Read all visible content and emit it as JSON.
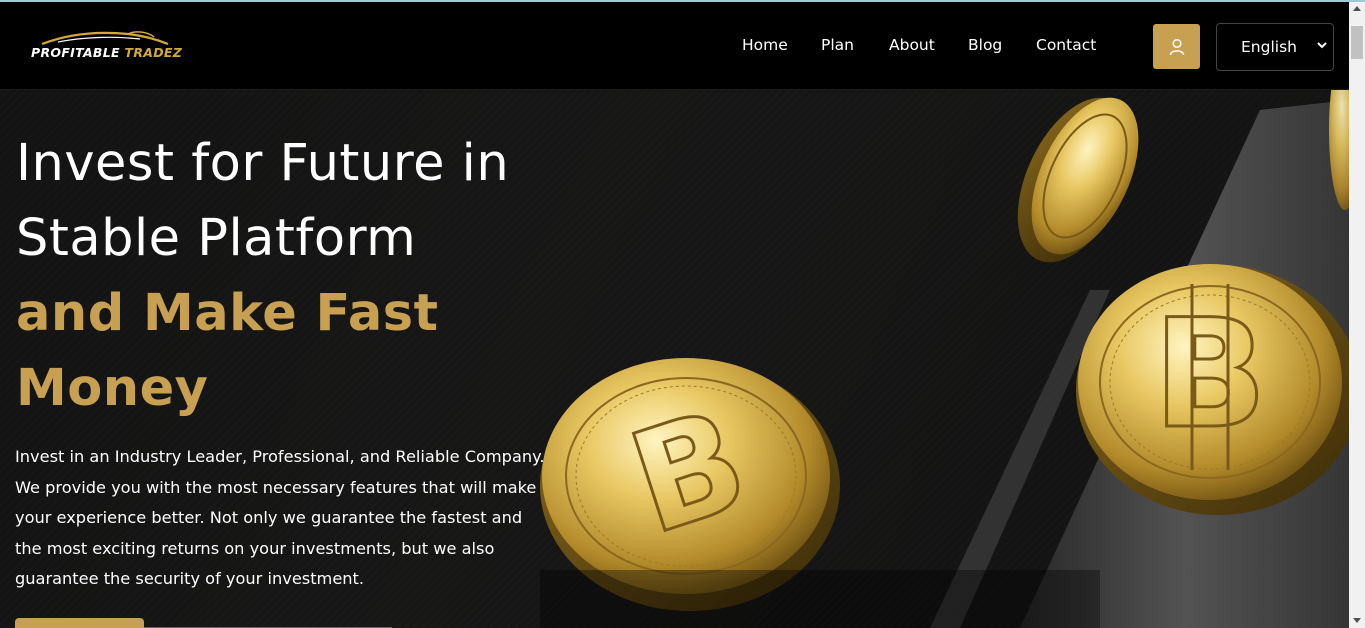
{
  "brand": {
    "logo_text_primary": "PROFITABLE",
    "logo_text_accent": "TRADEZ",
    "accent_color": "#c8a052"
  },
  "nav": {
    "items": [
      "Home",
      "Plan",
      "About",
      "Blog",
      "Contact"
    ]
  },
  "header": {
    "user_icon": "user-icon",
    "language_selected": "English"
  },
  "hero": {
    "title_line_1": "Invest for Future in",
    "title_line_2": "Stable Platform",
    "title_line_3": "and Make Fast",
    "title_line_4": "Money",
    "description": "Invest in an Industry Leader, Professional, and Reliable Company. We provide you with the most necessary features that will make your experience better. Not only we guarantee the fastest and the most exciting returns on your investments, but we also guarantee the security of your investment."
  },
  "colors": {
    "gold": "#c8a052",
    "background": "#000000"
  }
}
